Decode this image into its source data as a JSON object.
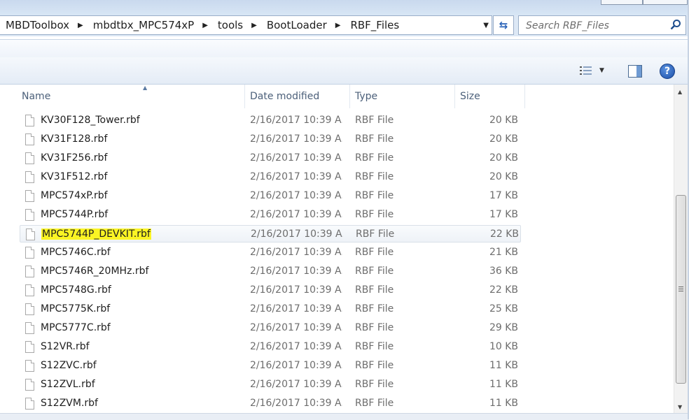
{
  "address_bar": {
    "breadcrumbs": [
      "MBDToolbox",
      "mbdtbx_MPC574xP",
      "tools",
      "BootLoader",
      "RBF_Files"
    ]
  },
  "search": {
    "placeholder": "Search RBF_Files"
  },
  "columns": {
    "name": "Name",
    "date": "Date modified",
    "type": "Type",
    "size": "Size"
  },
  "files": [
    {
      "name": "KV30F128_Tower.rbf",
      "date": "2/16/2017 10:39 A...",
      "type": "RBF File",
      "size": "20 KB"
    },
    {
      "name": "KV31F128.rbf",
      "date": "2/16/2017 10:39 A...",
      "type": "RBF File",
      "size": "20 KB"
    },
    {
      "name": "KV31F256.rbf",
      "date": "2/16/2017 10:39 A...",
      "type": "RBF File",
      "size": "20 KB"
    },
    {
      "name": "KV31F512.rbf",
      "date": "2/16/2017 10:39 A...",
      "type": "RBF File",
      "size": "20 KB"
    },
    {
      "name": "MPC574xP.rbf",
      "date": "2/16/2017 10:39 A...",
      "type": "RBF File",
      "size": "17 KB"
    },
    {
      "name": "MPC5744P.rbf",
      "date": "2/16/2017 10:39 A...",
      "type": "RBF File",
      "size": "17 KB"
    },
    {
      "name": "MPC5744P_DEVKIT.rbf",
      "date": "2/16/2017 10:39 A...",
      "type": "RBF File",
      "size": "22 KB",
      "selected": true
    },
    {
      "name": "MPC5746C.rbf",
      "date": "2/16/2017 10:39 A...",
      "type": "RBF File",
      "size": "21 KB"
    },
    {
      "name": "MPC5746R_20MHz.rbf",
      "date": "2/16/2017 10:39 A...",
      "type": "RBF File",
      "size": "36 KB"
    },
    {
      "name": "MPC5748G.rbf",
      "date": "2/16/2017 10:39 A...",
      "type": "RBF File",
      "size": "22 KB"
    },
    {
      "name": "MPC5775K.rbf",
      "date": "2/16/2017 10:39 A...",
      "type": "RBF File",
      "size": "25 KB"
    },
    {
      "name": "MPC5777C.rbf",
      "date": "2/16/2017 10:39 A...",
      "type": "RBF File",
      "size": "29 KB"
    },
    {
      "name": "S12VR.rbf",
      "date": "2/16/2017 10:39 A...",
      "type": "RBF File",
      "size": "10 KB"
    },
    {
      "name": "S12ZVC.rbf",
      "date": "2/16/2017 10:39 A...",
      "type": "RBF File",
      "size": "11 KB"
    },
    {
      "name": "S12ZVL.rbf",
      "date": "2/16/2017 10:39 A...",
      "type": "RBF File",
      "size": "11 KB"
    },
    {
      "name": "S12ZVM.rbf",
      "date": "2/16/2017 10:39 A...",
      "type": "RBF File",
      "size": "11 KB"
    }
  ],
  "colors": {
    "highlight": "#fbf424",
    "header_text": "#4c607a",
    "secondary_text": "#6d6d6d"
  },
  "icons": {
    "refresh": "refresh-icon",
    "search": "search-icon",
    "views": "views-icon",
    "preview": "preview-pane-icon",
    "help": "help-icon",
    "file": "file-icon"
  }
}
